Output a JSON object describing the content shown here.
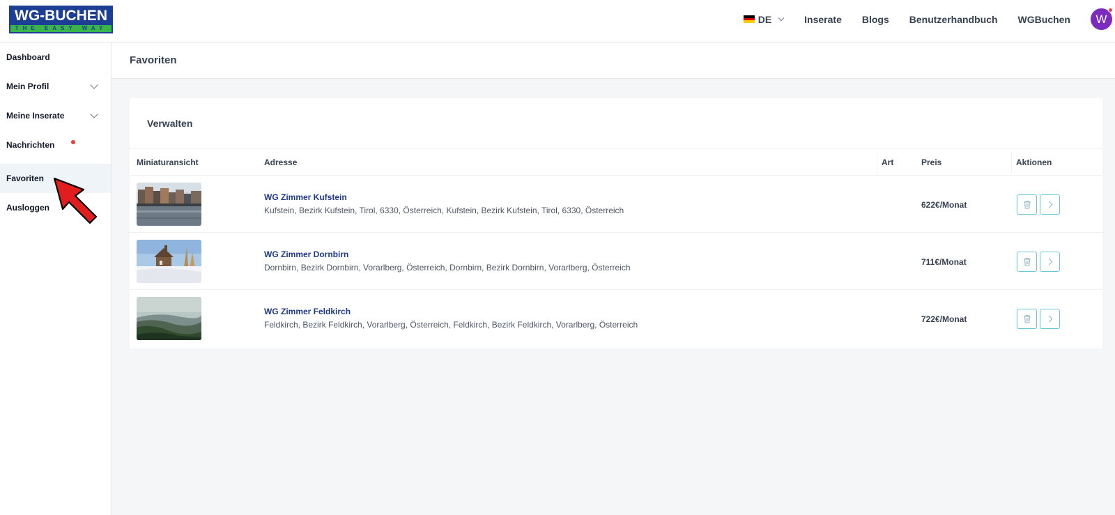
{
  "header": {
    "logo_top": "WG-BUCHEN",
    "logo_bottom": "THE EASY WAY",
    "language": "DE",
    "nav": [
      "Inserate",
      "Blogs",
      "Benutzerhandbuch",
      "WGBuchen"
    ],
    "avatar_letter": "W"
  },
  "sidebar": {
    "items": [
      {
        "label": "Dashboard"
      },
      {
        "label": "Mein Profil"
      },
      {
        "label": "Meine Inserate"
      },
      {
        "label": "Nachrichten"
      },
      {
        "label": "Favoriten"
      },
      {
        "label": "Ausloggen"
      }
    ]
  },
  "page": {
    "title": "Favoriten",
    "card_title": "Verwalten"
  },
  "table": {
    "headers": [
      "Miniaturansicht",
      "Adresse",
      "Art",
      "Preis",
      "Aktionen"
    ],
    "rows": [
      {
        "title": "WG Zimmer Kufstein",
        "address": "Kufstein, Bezirk Kufstein, Tirol, 6330, Österreich, Kufstein, Bezirk Kufstein, Tirol, 6330, Österreich",
        "art": "",
        "price": "622€/Monat"
      },
      {
        "title": "WG Zimmer Dornbirn",
        "address": "Dornbirn, Bezirk Dornbirn, Vorarlberg, Österreich, Dornbirn, Bezirk Dornbirn, Vorarlberg, Österreich",
        "art": "",
        "price": "711€/Monat"
      },
      {
        "title": "WG Zimmer Feldkirch",
        "address": "Feldkirch, Bezirk Feldkirch, Vorarlberg, Österreich, Feldkirch, Bezirk Feldkirch, Vorarlberg, Österreich",
        "art": "",
        "price": "722€/Monat"
      }
    ]
  },
  "colors": {
    "logo_blue": "#1c3f94",
    "logo_green": "#3ab54a",
    "avatar": "#7b2cbf",
    "link": "#1e3a8a",
    "action_border": "#67c9d6",
    "notification": "#e53e3e",
    "pointer": "#e11d1d"
  }
}
